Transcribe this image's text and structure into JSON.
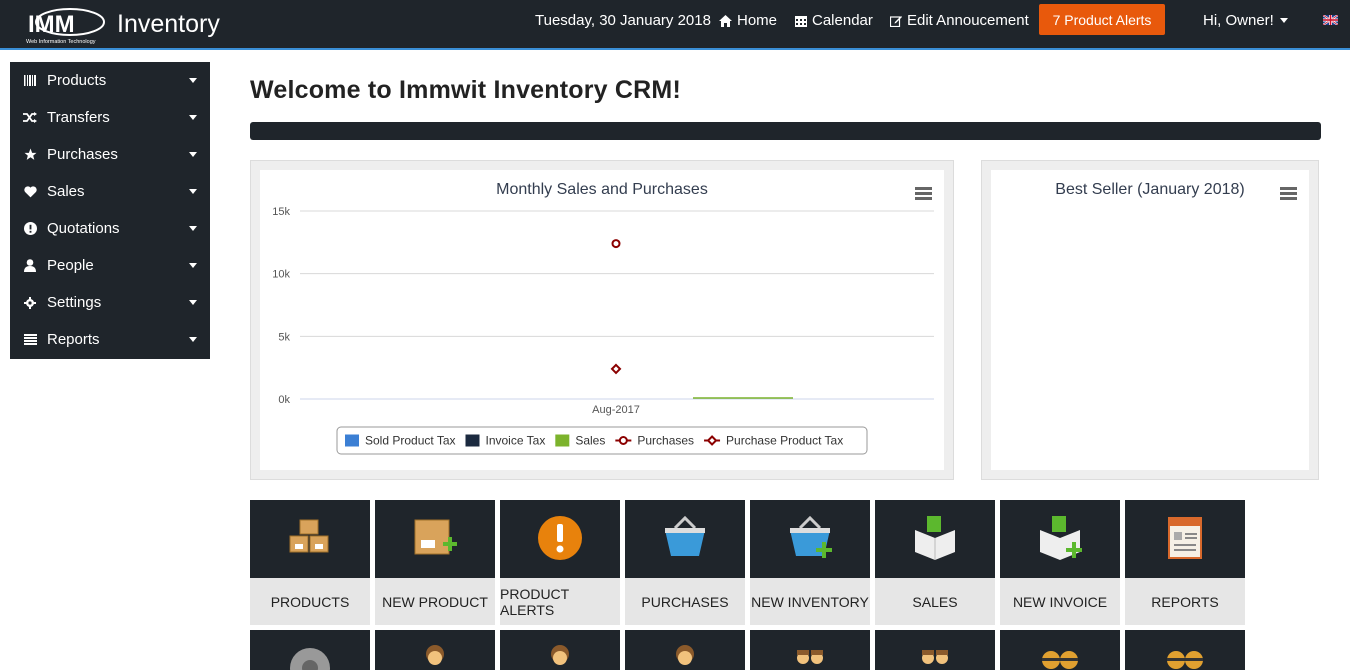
{
  "header": {
    "logo_text": "IMM",
    "logo_sub": "Web Information Technology",
    "brand": "Inventory",
    "date": "Tuesday, 30 January 2018",
    "home": "Home",
    "calendar": "Calendar",
    "edit_announcement": "Edit Annoucement",
    "alerts": "7 Product Alerts",
    "user": "Hi, Owner!"
  },
  "sidebar": {
    "items": [
      {
        "label": "Products",
        "icon": "barcode-icon"
      },
      {
        "label": "Transfers",
        "icon": "shuffle-icon"
      },
      {
        "label": "Purchases",
        "icon": "star-icon"
      },
      {
        "label": "Sales",
        "icon": "heart-icon"
      },
      {
        "label": "Quotations",
        "icon": "exclamation-icon"
      },
      {
        "label": "People",
        "icon": "user-icon"
      },
      {
        "label": "Settings",
        "icon": "gear-icon"
      },
      {
        "label": "Reports",
        "icon": "list-icon"
      }
    ]
  },
  "main": {
    "welcome": "Welcome to Immwit Inventory CRM!",
    "best_seller_title": "Best Seller (January 2018)"
  },
  "chart_data": {
    "type": "line",
    "title": "Monthly Sales and Purchases",
    "categories": [
      "Aug-2017"
    ],
    "ylim": [
      0,
      15000
    ],
    "yticks": [
      "0k",
      "5k",
      "10k",
      "15k"
    ],
    "grid": true,
    "legend_position": "bottom",
    "series": [
      {
        "name": "Sold Product Tax",
        "values": [
          0
        ],
        "color": "#3b7fd4",
        "marker": "square"
      },
      {
        "name": "Invoice Tax",
        "values": [
          0
        ],
        "color": "#1b2a3f",
        "marker": "square"
      },
      {
        "name": "Sales",
        "values": [
          0
        ],
        "color": "#7cb32c",
        "marker": "square"
      },
      {
        "name": "Purchases",
        "values": [
          12400
        ],
        "color": "#8b0000",
        "marker": "circle"
      },
      {
        "name": "Purchase Product Tax",
        "values": [
          2400
        ],
        "color": "#8b0000",
        "marker": "diamond"
      }
    ]
  },
  "tiles": [
    {
      "label": "PRODUCTS",
      "icon": "boxes-icon"
    },
    {
      "label": "NEW PRODUCT",
      "icon": "new-product-icon"
    },
    {
      "label": "PRODUCT ALERTS",
      "icon": "alert-icon"
    },
    {
      "label": "PURCHASES",
      "icon": "basket-icon"
    },
    {
      "label": "NEW INVENTORY",
      "icon": "basket-add-icon"
    },
    {
      "label": "SALES",
      "icon": "money-box-icon"
    },
    {
      "label": "NEW INVOICE",
      "icon": "money-box-add-icon"
    },
    {
      "label": "REPORTS",
      "icon": "report-icon"
    }
  ],
  "colors": {
    "dark": "#1f252b",
    "accent": "#e8590c",
    "border_blue": "#3a8fd6"
  }
}
